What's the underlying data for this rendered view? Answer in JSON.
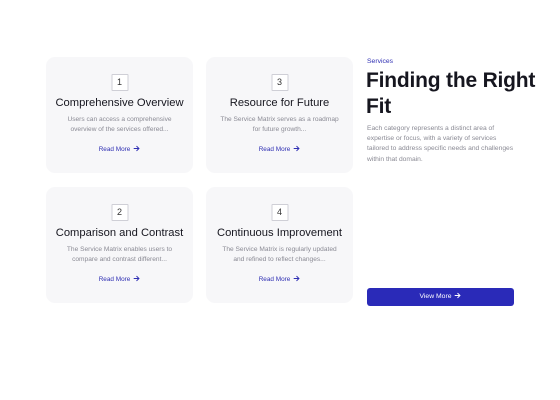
{
  "cards": [
    {
      "number": "1",
      "title": "Comprehensive Overview",
      "description": "Users can access a comprehensive overview of the services offered...",
      "link_label": "Read More"
    },
    {
      "number": "3",
      "title": "Resource for Future",
      "description": "The Service Matrix serves as a roadmap for future growth...",
      "link_label": "Read More"
    },
    {
      "number": "2",
      "title": "Comparison and Contrast",
      "description": "The Service Matrix enables users to compare and contrast different...",
      "link_label": "Read More"
    },
    {
      "number": "4",
      "title": "Continuous Improvement",
      "description": "The Service Matrix is regularly updated and refined to reflect changes...",
      "link_label": "Read More"
    }
  ],
  "section": {
    "eyebrow": "Services",
    "heading": "Finding the Right Fit",
    "intro": "Each category represents a distinct area of expertise or focus, with a variety of services tailored to address specific needs and challenges within that domain.",
    "button_label": "View More"
  },
  "colors": {
    "accent": "#2a2ab8",
    "card_bg": "#f7f7f9",
    "muted_text": "#8a8a94"
  },
  "icons": {
    "link_arrow": "arrow-right-icon"
  }
}
